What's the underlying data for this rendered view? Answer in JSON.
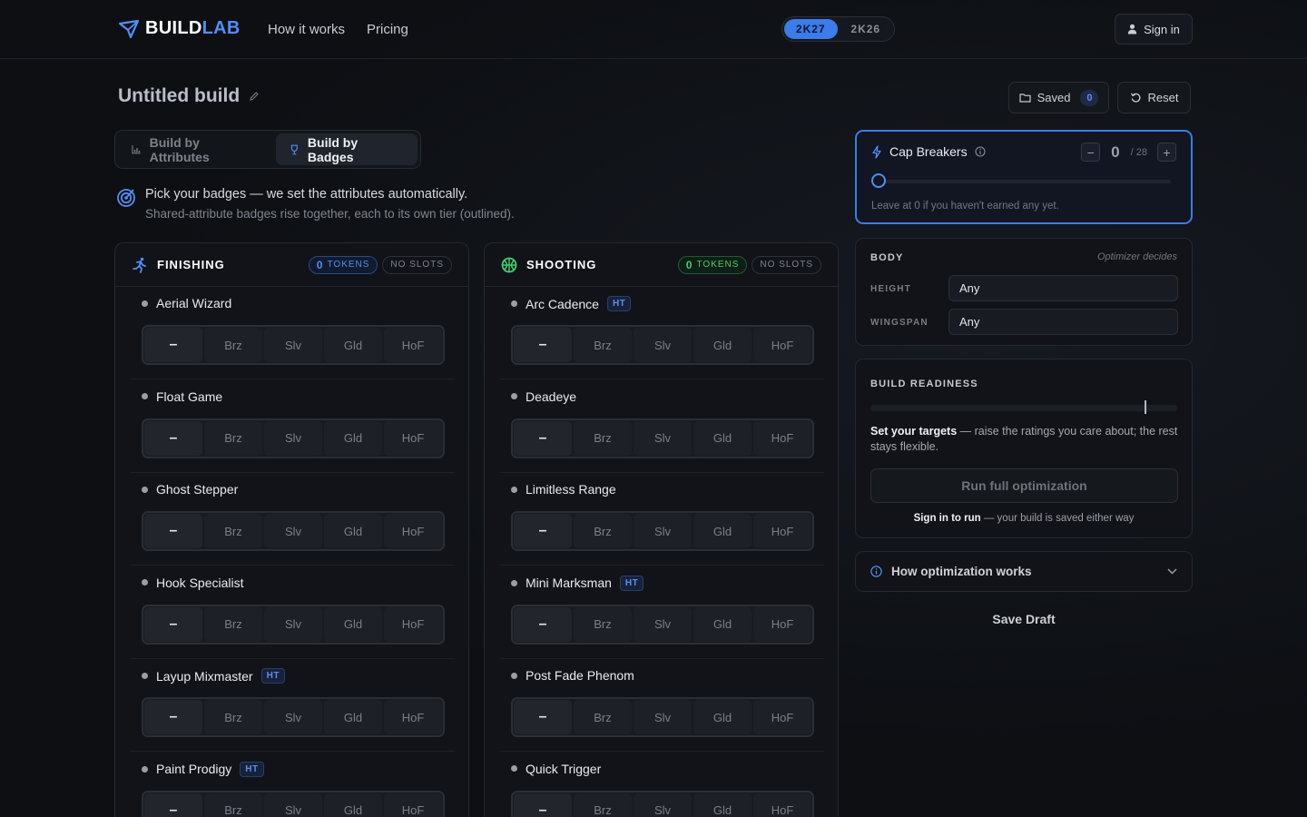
{
  "brand": {
    "part1": "BUILD",
    "part2": "LAB"
  },
  "nav": {
    "how_it_works": "How it works",
    "pricing": "Pricing"
  },
  "version": {
    "options": [
      "2K27",
      "2K26"
    ],
    "selected": "2K27"
  },
  "auth": {
    "sign_in": "Sign in"
  },
  "build": {
    "title": "Untitled build"
  },
  "actions": {
    "saved_label": "Saved",
    "saved_count": "0",
    "reset_label": "Reset"
  },
  "mode_tabs": {
    "attributes": "Build by Attributes",
    "badges": "Build by Badges",
    "active": "badges"
  },
  "intro": {
    "line1": "Pick your badges — we set the attributes automatically.",
    "line2": "Shared-attribute badges rise together, each to its own tier (outlined)."
  },
  "tier_labels": [
    "–",
    "Brz",
    "Slv",
    "Gld",
    "HoF"
  ],
  "categories": [
    {
      "title": "FINISHING",
      "tokens_count": "0",
      "tokens_label": "TOKENS",
      "slots": "NO SLOTS",
      "badges": [
        {
          "name": "Aerial Wizard",
          "ht": ""
        },
        {
          "name": "Float Game",
          "ht": ""
        },
        {
          "name": "Ghost Stepper",
          "ht": ""
        },
        {
          "name": "Hook Specialist",
          "ht": ""
        },
        {
          "name": "Layup Mixmaster",
          "ht": "HT"
        },
        {
          "name": "Paint Prodigy",
          "ht": "HT"
        }
      ]
    },
    {
      "title": "SHOOTING",
      "tokens_count": "0",
      "tokens_label": "TOKENS",
      "slots": "NO SLOTS",
      "badges": [
        {
          "name": "Arc Cadence",
          "ht": "HT"
        },
        {
          "name": "Deadeye",
          "ht": ""
        },
        {
          "name": "Limitless Range",
          "ht": ""
        },
        {
          "name": "Mini Marksman",
          "ht": "HT"
        },
        {
          "name": "Post Fade Phenom",
          "ht": ""
        },
        {
          "name": "Quick Trigger",
          "ht": ""
        }
      ]
    }
  ],
  "cap_breakers": {
    "title": "Cap Breakers",
    "value": "0",
    "max": "/ 28",
    "level_fraction": 0,
    "hint": "Leave at 0 if you haven't earned any yet."
  },
  "body": {
    "label": "BODY",
    "optimizer_note": "Optimizer decides",
    "height_label": "HEIGHT",
    "height_value": "Any",
    "wingspan_label": "WINGSPAN",
    "wingspan_value": "Any"
  },
  "readiness": {
    "label": "BUILD READINESS",
    "targets_bold": "Set your targets",
    "targets_rest": " — raise the ratings you care about; the rest stays flexible.",
    "run_button": "Run full optimization",
    "signin_bold": "Sign in to run",
    "signin_rest": " — your build is saved either way"
  },
  "how_optimization": {
    "label": "How optimization works"
  },
  "save_draft": "Save Draft",
  "colors": {
    "accent": "#3b7bea",
    "green": "#3fcf6f"
  }
}
